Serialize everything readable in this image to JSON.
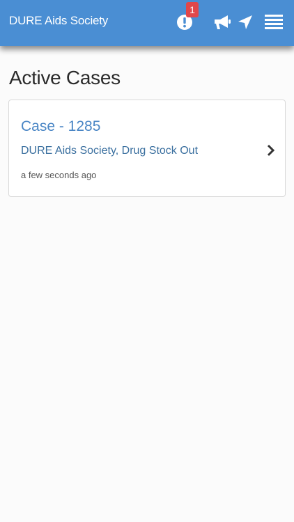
{
  "header": {
    "app_title": "DURE Aids Society",
    "alert_badge_count": "1",
    "icons": [
      "alert-icon",
      "megaphone-icon",
      "navigation-arrow-icon",
      "menu-icon"
    ],
    "bar_color": "#4a8ed3",
    "badge_color": "#e1474a"
  },
  "main": {
    "page_title": "Active Cases",
    "cases": [
      {
        "title": "Case - 1285",
        "subtitle": "DURE Aids Society, Drug Stock Out",
        "time": "a few seconds ago"
      }
    ]
  }
}
